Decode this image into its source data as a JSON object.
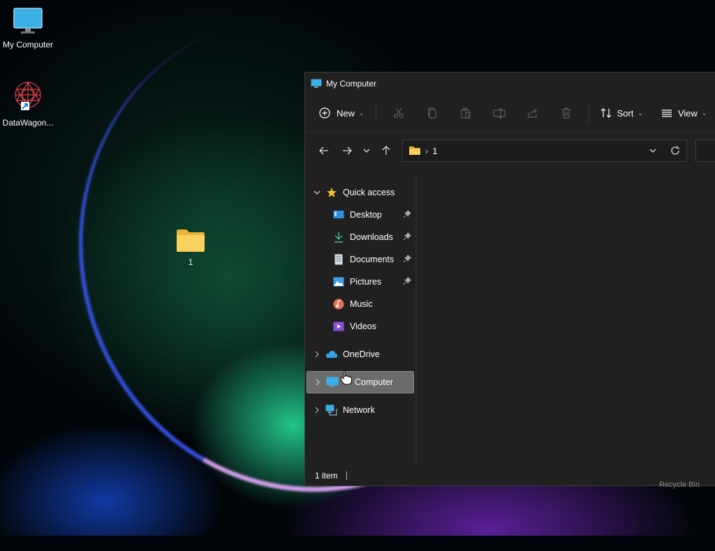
{
  "desktop": {
    "icons": [
      {
        "label": "My Computer",
        "icon": "monitor-icon"
      },
      {
        "label": "DataWagon...",
        "icon": "datawagon-app-icon"
      },
      {
        "label": "1",
        "icon": "folder-icon"
      }
    ],
    "recycle_bin_label": "Recycle Bin"
  },
  "window": {
    "title": "My Computer",
    "commands": {
      "new_label": "New",
      "sort_label": "Sort",
      "view_label": "View",
      "disabled_tools": [
        "cut-icon",
        "copy-icon",
        "paste-icon",
        "rename-icon",
        "share-icon",
        "delete-icon"
      ]
    },
    "address": {
      "path": "1",
      "icon": "folder-icon"
    },
    "nav": {
      "quick_access": "Quick access",
      "items": [
        {
          "label": "Desktop",
          "icon": "desktop-icon",
          "pinned": true
        },
        {
          "label": "Downloads",
          "icon": "download-arrow-icon",
          "pinned": true
        },
        {
          "label": "Documents",
          "icon": "document-icon",
          "pinned": true
        },
        {
          "label": "Pictures",
          "icon": "pictures-icon",
          "pinned": true
        },
        {
          "label": "Music",
          "icon": "music-icon",
          "pinned": false
        },
        {
          "label": "Videos",
          "icon": "videos-icon",
          "pinned": false
        }
      ],
      "onedrive": "OneDrive",
      "computer": "Computer",
      "network": "Network"
    },
    "status": {
      "item_count": "1 item"
    }
  },
  "colors": {
    "window_bg": "#202020",
    "folder_yellow": "#f7c948",
    "accent_blue": "#4fb3e8",
    "selection": "#6b6b6b"
  }
}
